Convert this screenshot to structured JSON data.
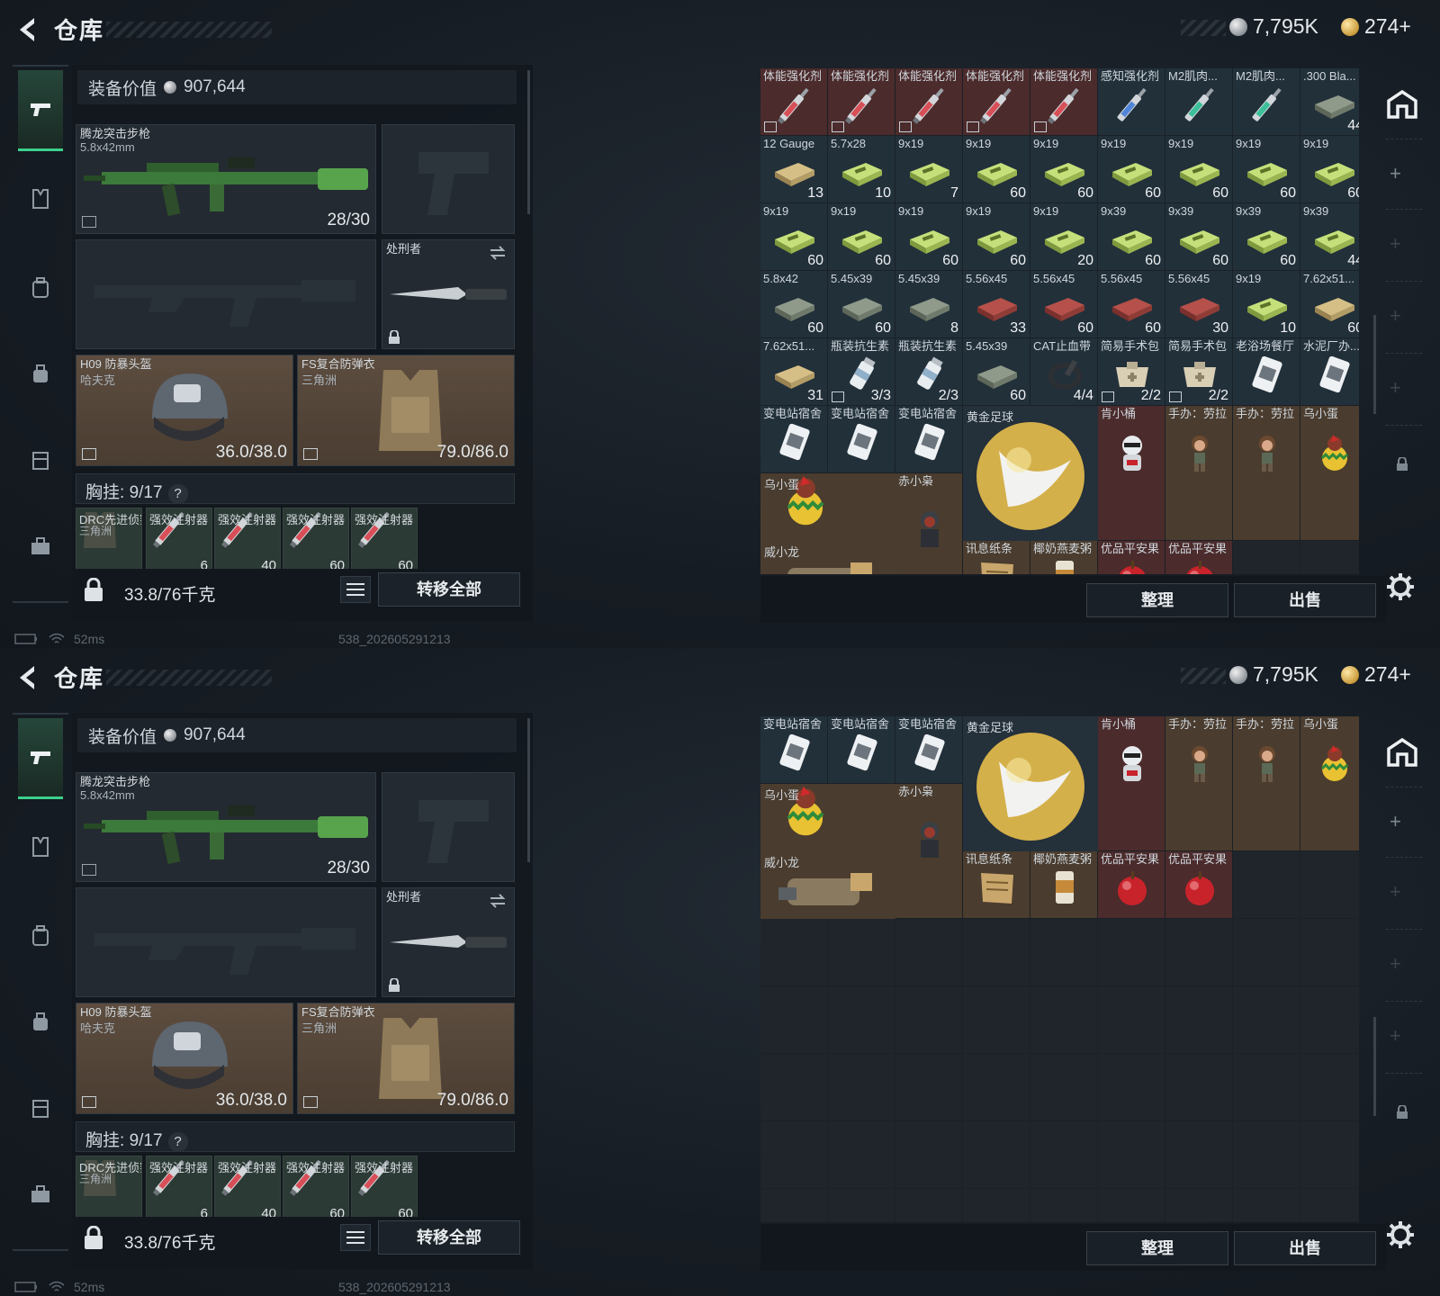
{
  "header": {
    "title": "仓库",
    "silver": "7,795K",
    "gold": "274+"
  },
  "equip": {
    "label": "装备价值",
    "value": "907,644"
  },
  "primary": {
    "name": "腾龙突击步枪",
    "caliber": "5.8x42mm",
    "ammo": "28/30"
  },
  "melee": {
    "name": "处刑者"
  },
  "helmet": {
    "name": "H09 防暴头盔",
    "sub": "哈夫克",
    "dur": "36.0/38.0"
  },
  "armor": {
    "name": "FS复合防弹衣",
    "sub": "三角洲",
    "dur": "79.0/86.0"
  },
  "chest": {
    "label": "胸挂:",
    "value": "9/17",
    "q": "?"
  },
  "chest_items": [
    {
      "name": "DRC先进侦察...",
      "sub": "三角洲",
      "count": ""
    },
    {
      "name": "强效注射器",
      "sub": "",
      "count": "6"
    },
    {
      "name": "强效注射器",
      "sub": "",
      "count": "40"
    },
    {
      "name": "强效注射器",
      "sub": "",
      "count": "60"
    },
    {
      "name": "强效注射器",
      "sub": "",
      "count": "60"
    }
  ],
  "bottom": {
    "weight": "33.8/76千克",
    "transfer": "转移全部"
  },
  "status": {
    "ms": "52ms",
    "build": "538_202605291213"
  },
  "buttons": {
    "sort": "整理",
    "sell": "出售"
  },
  "grid1": [
    [
      {
        "n": "体能强化剂",
        "c": "",
        "k": "syringe-red",
        "t": "r",
        "ns": true
      },
      {
        "n": "体能强化剂",
        "c": "",
        "k": "syringe-red",
        "t": "r",
        "ns": true
      },
      {
        "n": "体能强化剂",
        "c": "",
        "k": "syringe-red",
        "t": "r",
        "ns": true
      },
      {
        "n": "体能强化剂",
        "c": "",
        "k": "syringe-red",
        "t": "r",
        "ns": true
      },
      {
        "n": "体能强化剂",
        "c": "",
        "k": "syringe-red",
        "t": "r",
        "ns": true
      },
      {
        "n": "感知强化剂",
        "c": "",
        "k": "syringe-blue",
        "t": "",
        "ns": false
      },
      {
        "n": "M2肌肉...",
        "c": "",
        "k": "syringe-green",
        "t": "",
        "ns": false
      },
      {
        "n": "M2肌肉...",
        "c": "",
        "k": "syringe-green",
        "t": "",
        "ns": false
      },
      {
        "n": ".300 Bla...",
        "c": "44",
        "k": "ammo",
        "t": "",
        "ns": false
      }
    ],
    [
      {
        "n": "12 Gauge",
        "c": "13",
        "k": "ammo-tan",
        "t": "",
        "ns": false
      },
      {
        "n": "5.7x28",
        "c": "10",
        "k": "ammo-green",
        "t": "",
        "ns": false
      },
      {
        "n": "9x19",
        "c": "7",
        "k": "ammo-green",
        "t": "",
        "ns": false
      },
      {
        "n": "9x19",
        "c": "60",
        "k": "ammo-green",
        "t": "",
        "ns": false
      },
      {
        "n": "9x19",
        "c": "60",
        "k": "ammo-green",
        "t": "",
        "ns": false
      },
      {
        "n": "9x19",
        "c": "60",
        "k": "ammo-green",
        "t": "",
        "ns": false
      },
      {
        "n": "9x19",
        "c": "60",
        "k": "ammo-green",
        "t": "",
        "ns": false
      },
      {
        "n": "9x19",
        "c": "60",
        "k": "ammo-green",
        "t": "",
        "ns": false
      },
      {
        "n": "9x19",
        "c": "60",
        "k": "ammo-green",
        "t": "",
        "ns": false
      }
    ],
    [
      {
        "n": "9x19",
        "c": "60",
        "k": "ammo-green",
        "t": "",
        "ns": false
      },
      {
        "n": "9x19",
        "c": "60",
        "k": "ammo-green",
        "t": "",
        "ns": false
      },
      {
        "n": "9x19",
        "c": "60",
        "k": "ammo-green",
        "t": "",
        "ns": false
      },
      {
        "n": "9x19",
        "c": "60",
        "k": "ammo-green",
        "t": "",
        "ns": false
      },
      {
        "n": "9x19",
        "c": "20",
        "k": "ammo-green",
        "t": "",
        "ns": false
      },
      {
        "n": "9x39",
        "c": "60",
        "k": "ammo-green",
        "t": "",
        "ns": false
      },
      {
        "n": "9x39",
        "c": "60",
        "k": "ammo-green",
        "t": "",
        "ns": false
      },
      {
        "n": "9x39",
        "c": "60",
        "k": "ammo-green",
        "t": "",
        "ns": false
      },
      {
        "n": "9x39",
        "c": "44",
        "k": "ammo-green",
        "t": "",
        "ns": false
      }
    ],
    [
      {
        "n": "5.8x42",
        "c": "60",
        "k": "ammo",
        "t": "",
        "ns": false
      },
      {
        "n": "5.45x39",
        "c": "60",
        "k": "ammo",
        "t": "",
        "ns": false
      },
      {
        "n": "5.45x39",
        "c": "8",
        "k": "ammo",
        "t": "",
        "ns": false
      },
      {
        "n": "5.56x45",
        "c": "33",
        "k": "ammo-red",
        "t": "",
        "ns": false
      },
      {
        "n": "5.56x45",
        "c": "60",
        "k": "ammo-red",
        "t": "",
        "ns": false
      },
      {
        "n": "5.56x45",
        "c": "60",
        "k": "ammo-red",
        "t": "",
        "ns": false
      },
      {
        "n": "5.56x45",
        "c": "30",
        "k": "ammo-red",
        "t": "",
        "ns": false
      },
      {
        "n": "9x19",
        "c": "10",
        "k": "ammo-green",
        "t": "",
        "ns": false
      },
      {
        "n": "7.62x51...",
        "c": "60",
        "k": "ammo-tan",
        "t": "",
        "ns": false
      }
    ],
    [
      {
        "n": "7.62x51...",
        "c": "31",
        "k": "ammo-tan",
        "t": "",
        "ns": false
      },
      {
        "n": "瓶装抗生素",
        "c": "3/3",
        "k": "bottle",
        "t": "",
        "ns": true
      },
      {
        "n": "瓶装抗生素",
        "c": "2/3",
        "k": "bottle",
        "t": "",
        "ns": false
      },
      {
        "n": "5.45x39",
        "c": "60",
        "k": "ammo",
        "t": "",
        "ns": false
      },
      {
        "n": "CAT止血带",
        "c": "4/4",
        "k": "tourniquet",
        "t": "",
        "ns": false
      },
      {
        "n": "简易手术包",
        "c": "2/2",
        "k": "kit",
        "t": "",
        "ns": true
      },
      {
        "n": "简易手术包",
        "c": "2/2",
        "k": "kit",
        "t": "",
        "ns": true
      },
      {
        "n": "老浴场餐厅",
        "c": "",
        "k": "card",
        "t": "",
        "ns": false
      },
      {
        "n": "水泥厂办...",
        "c": "",
        "k": "card",
        "t": "",
        "ns": false
      }
    ]
  ],
  "collect": {
    "row1": [
      {
        "n": "变电站宿舍",
        "k": "card"
      },
      {
        "n": "变电站宿舍",
        "k": "card"
      },
      {
        "n": "变电站宿舍",
        "k": "card"
      }
    ],
    "ball": "黄金足球",
    "figs": [
      {
        "n": "肯小桶",
        "k": "kfc"
      },
      {
        "n": "手办：劳拉",
        "k": "lara"
      },
      {
        "n": "手办：劳拉",
        "k": "lara"
      },
      {
        "n": "乌小蛋",
        "k": "egg"
      }
    ],
    "wu": "乌小蛋",
    "chi": "赤小枭",
    "wei": "威小龙",
    "row3": [
      {
        "n": "讯息纸条",
        "k": "paper"
      },
      {
        "n": "椰奶燕麦粥",
        "k": "can"
      },
      {
        "n": "优品平安果",
        "k": "apple"
      },
      {
        "n": "优品平安果",
        "k": "apple"
      }
    ]
  }
}
